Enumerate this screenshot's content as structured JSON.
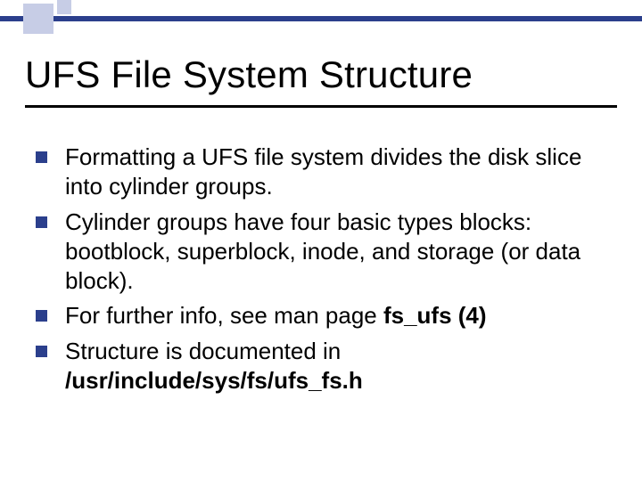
{
  "title": "UFS File System Structure",
  "bullets": {
    "b0": "Formatting a UFS file system divides the disk slice into cylinder groups.",
    "b1": "Cylinder groups have four basic types blocks: bootblock, superblock, inode, and storage (or data block).",
    "b2_pre": "For further info, see man page ",
    "b2_bold": "fs_ufs (4)",
    "b3_pre": "Structure is documented in ",
    "b3_bold": "/usr/include/sys/fs/ufs_fs.h"
  }
}
